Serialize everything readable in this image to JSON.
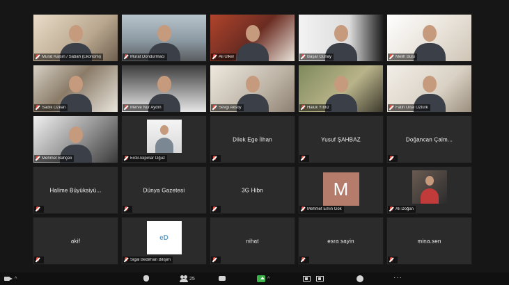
{
  "participants": [
    {
      "label": "Murat Kalsın / Sabah (Ekonomi)",
      "mode": "video",
      "bg": "bg1"
    },
    {
      "label": "Murat Dondurmacı",
      "mode": "video",
      "bg": "bg2"
    },
    {
      "label": "Ali Ülker",
      "mode": "video",
      "bg": "bg3"
    },
    {
      "label": "Başar Günay",
      "mode": "video",
      "bg": "bg4"
    },
    {
      "label": "Melih Bulu",
      "mode": "video",
      "bg": "bg5"
    },
    {
      "label": "Sadık Özkan",
      "mode": "video",
      "bg": "bg6"
    },
    {
      "label": "Merve Nur Aydın",
      "mode": "video",
      "bg": "bg7"
    },
    {
      "label": "Sevgi Aksoy",
      "mode": "video",
      "bg": "bg8"
    },
    {
      "label": "Haluk Yıldız",
      "mode": "video",
      "bg": "bg9"
    },
    {
      "label": "Fatih Ünal Öztürk",
      "mode": "video",
      "bg": "bg10"
    },
    {
      "label": "Mehmet Bahçeli",
      "mode": "video",
      "bg": "bg11"
    },
    {
      "label": "Erdil Akpınar Oğuz",
      "mode": "photo"
    },
    {
      "name": "Dilek Ege İlhan",
      "mode": "name"
    },
    {
      "name": "Yusuf ŞAHBAZ",
      "mode": "name"
    },
    {
      "name": "Doğancan Çalm...",
      "mode": "name"
    },
    {
      "name": "Halime Büyüksiyü...",
      "mode": "name"
    },
    {
      "name": "Dünya Gazetesi",
      "mode": "name"
    },
    {
      "name": "3G Hibn",
      "mode": "name"
    },
    {
      "label": "Mehmet Emin Gök",
      "mode": "avatar",
      "letter": "M"
    },
    {
      "label": "Ali Doğan",
      "mode": "photo2"
    },
    {
      "name": "akif",
      "mode": "name"
    },
    {
      "label": "Sigal Bedirhan Bilişim",
      "mode": "logo",
      "logo_text": "eD"
    },
    {
      "name": "nihat",
      "mode": "name"
    },
    {
      "name": "esra sayin",
      "mode": "name"
    },
    {
      "name": "mina.sen",
      "mode": "name"
    }
  ],
  "toolbar": {
    "participants_count": "25",
    "caret": "^",
    "more": "···"
  },
  "colors": {
    "background": "#161616",
    "tile": "#2b2b2b",
    "muted_mic": "#e84a3c",
    "share_green": "#3cb34a"
  }
}
